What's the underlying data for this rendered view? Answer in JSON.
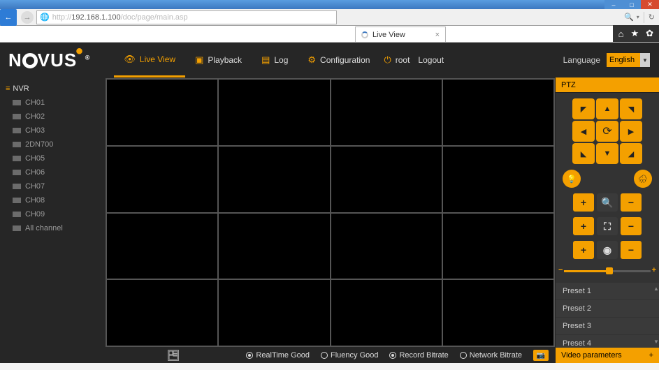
{
  "window": {
    "min": "–",
    "max": "□",
    "close": "✕"
  },
  "browser": {
    "url_prefix": "http://",
    "url_host": "192.168.1.100",
    "url_path": "/doc/page/main.asp",
    "search_hint": "🔍",
    "refresh": "↻",
    "tab_title": "Live View",
    "tab_close": "×",
    "home": "⌂",
    "star": "★",
    "gear": "✿"
  },
  "logo": {
    "text1": "N",
    "text2": "VUS",
    "reg": "®"
  },
  "nav": {
    "live_view": "Live View",
    "playback": "Playback",
    "log": "Log",
    "configuration": "Configuration",
    "user_prefix": "root",
    "logout": "Logout"
  },
  "language": {
    "label": "Language",
    "value": "English"
  },
  "tree": {
    "root": "NVR",
    "channels": [
      "CH01",
      "CH02",
      "CH03",
      "2DN700",
      "CH05",
      "CH06",
      "CH07",
      "CH08",
      "CH09",
      "All channel"
    ]
  },
  "bottom": {
    "realtime": "RealTime Good",
    "fluency": "Fluency Good",
    "record": "Record Bitrate",
    "network": "Network Bitrate"
  },
  "ptz": {
    "title": "PTZ",
    "presets": [
      "Preset 1",
      "Preset 2",
      "Preset 3",
      "Preset 4"
    ],
    "video_params": "Video parameters"
  }
}
